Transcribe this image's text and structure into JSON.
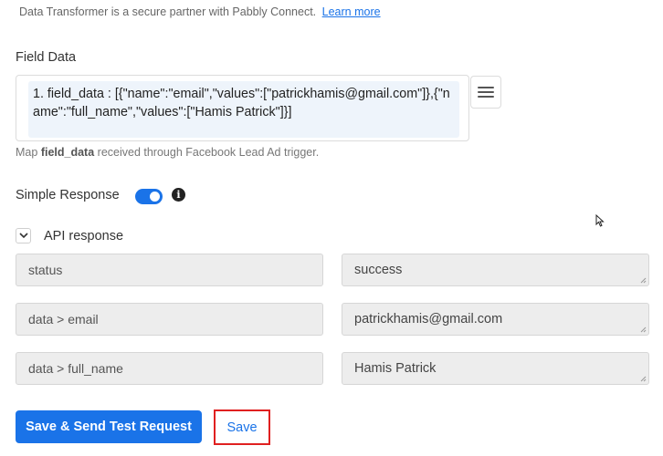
{
  "note": {
    "text": "Data Transformer is a secure partner with Pabbly Connect.",
    "link": "Learn more"
  },
  "field_data": {
    "label": "Field Data",
    "value": "1. field_data : [{\"name\":\"email\",\"values\":[\"patrickhamis@gmail.com\"]},{\"name\":\"full_name\",\"values\":[\"Hamis Patrick\"]}]",
    "help_prefix": "Map",
    "help_bold": "field_data",
    "help_suffix": "received through Facebook Lead Ad trigger."
  },
  "simple_response": {
    "label": "Simple Response",
    "enabled": true,
    "info_glyph": "i"
  },
  "api_response": {
    "label": "API response",
    "rows": [
      {
        "key": "status",
        "value": "success"
      },
      {
        "key": "data > email",
        "value": "patrickhamis@gmail.com"
      },
      {
        "key": "data > full_name",
        "value": "Hamis Patrick"
      }
    ]
  },
  "buttons": {
    "send_test": "Save & Send Test Request",
    "save": "Save"
  },
  "colors": {
    "accent": "#1a73e8",
    "highlight_border": "#e02020"
  },
  "icons": {
    "menu": "hamburger-icon",
    "info": "info-icon",
    "chevron": "chevron-down-icon",
    "cursor": "mouse-cursor-icon",
    "resize": "resize-handle-icon"
  }
}
